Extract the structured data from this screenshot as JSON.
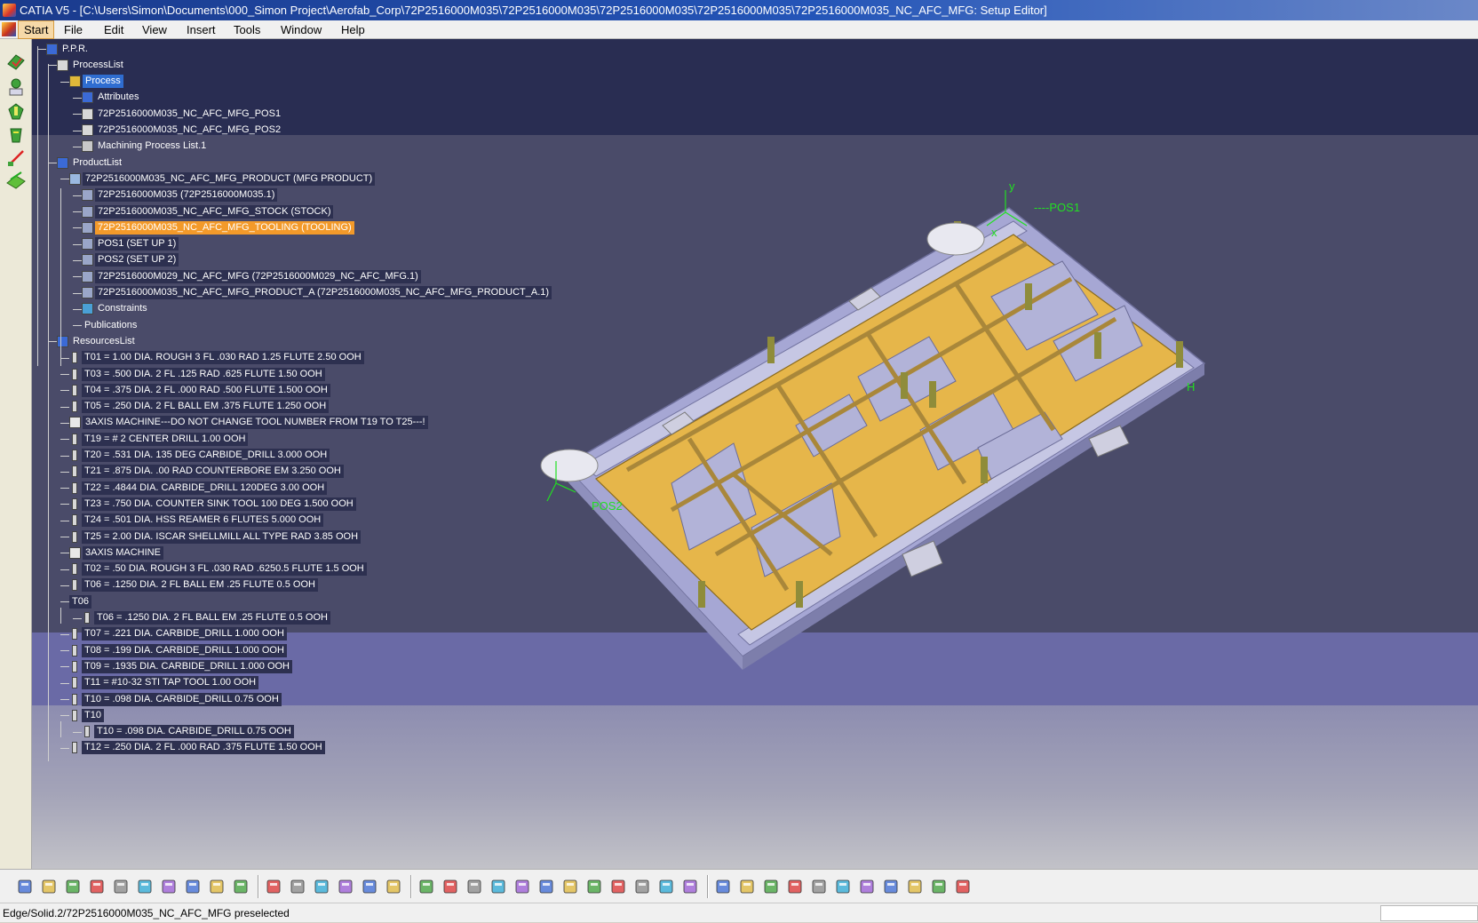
{
  "window": {
    "title": "CATIA V5 - [C:\\Users\\Simon\\Documents\\000_Simon Project\\Aerofab_Corp\\72P2516000M035\\72P2516000M035\\72P2516000M035\\72P2516000M035\\72P2516000M035_NC_AFC_MFG: Setup Editor]"
  },
  "menu": {
    "items": [
      {
        "label": "Start",
        "active": true
      },
      {
        "label": "File"
      },
      {
        "label": "Edit"
      },
      {
        "label": "View"
      },
      {
        "label": "Insert"
      },
      {
        "label": "Tools"
      },
      {
        "label": "Window"
      },
      {
        "label": "Help"
      }
    ]
  },
  "tree": {
    "nodes": [
      {
        "label": "P.P.R.",
        "level": 0,
        "icon": "ppr-icon",
        "style": "plain"
      },
      {
        "label": "ProcessList",
        "level": 1,
        "icon": "process-list-icon",
        "style": "plain"
      },
      {
        "label": "Process",
        "level": 2,
        "icon": "process-gear-icon",
        "style": "sel"
      },
      {
        "label": "Attributes",
        "level": 3,
        "icon": "attributes-icon",
        "style": "plain"
      },
      {
        "label": "72P2516000M035_NC_AFC_MFG_POS1",
        "level": 3,
        "icon": "part-operation-icon",
        "style": "plain"
      },
      {
        "label": "72P2516000M035_NC_AFC_MFG_POS2",
        "level": 3,
        "icon": "part-operation-icon",
        "style": "plain"
      },
      {
        "label": "Machining Process List.1",
        "level": 3,
        "icon": "machining-process-icon",
        "style": "plain"
      },
      {
        "label": "ProductList",
        "level": 1,
        "icon": "product-list-icon",
        "style": "plain"
      },
      {
        "label": "72P2516000M035_NC_AFC_MFG_PRODUCT (MFG PRODUCT)",
        "level": 2,
        "icon": "product-icon",
        "style": "box"
      },
      {
        "label": "72P2516000M035 (72P2516000M035.1)",
        "level": 3,
        "icon": "component-icon",
        "style": "box"
      },
      {
        "label": "72P2516000M035_NC_AFC_MFG_STOCK (STOCK)",
        "level": 3,
        "icon": "component-icon",
        "style": "box"
      },
      {
        "label": "72P2516000M035_NC_AFC_MFG_TOOLING (TOOLING)",
        "level": 3,
        "icon": "component-icon",
        "style": "hi"
      },
      {
        "label": "POS1 (SET UP 1)",
        "level": 3,
        "icon": "component-icon",
        "style": "box"
      },
      {
        "label": "POS2 (SET UP 2)",
        "level": 3,
        "icon": "component-icon",
        "style": "box"
      },
      {
        "label": "72P2516000M029_NC_AFC_MFG (72P2516000M029_NC_AFC_MFG.1)",
        "level": 3,
        "icon": "component-icon",
        "style": "box"
      },
      {
        "label": "72P2516000M035_NC_AFC_MFG_PRODUCT_A (72P2516000M035_NC_AFC_MFG_PRODUCT_A.1)",
        "level": 3,
        "icon": "component-icon",
        "style": "box"
      },
      {
        "label": "Constraints",
        "level": 3,
        "icon": "constraints-icon",
        "style": "plain"
      },
      {
        "label": "Publications",
        "level": 3,
        "icon": "none",
        "style": "plain"
      },
      {
        "label": "ResourcesList",
        "level": 1,
        "icon": "resources-list-icon",
        "style": "plain"
      },
      {
        "label": "T01 = 1.00 DIA. ROUGH 3 FL .030 RAD 1.25 FLUTE 2.50 OOH",
        "level": 2,
        "icon": "tool-icon",
        "style": "box"
      },
      {
        "label": "T03 = .500 DIA. 2 FL .125 RAD .625 FLUTE 1.50 OOH",
        "level": 2,
        "icon": "tool-icon",
        "style": "box"
      },
      {
        "label": "T04 = .375 DIA. 2 FL .000 RAD .500 FLUTE 1.500 OOH",
        "level": 2,
        "icon": "tool-icon",
        "style": "box"
      },
      {
        "label": "T05 = .250 DIA. 2 FL BALL EM .375 FLUTE 1.250 OOH",
        "level": 2,
        "icon": "tool-icon",
        "style": "box"
      },
      {
        "label": "3AXIS MACHINE---DO NOT CHANGE TOOL NUMBER FROM T19 TO T25---!",
        "level": 2,
        "icon": "machine-icon",
        "style": "box"
      },
      {
        "label": "T19 = # 2 CENTER DRILL 1.00 OOH",
        "level": 2,
        "icon": "tool-icon",
        "style": "box"
      },
      {
        "label": "T20 = .531 DIA. 135 DEG CARBIDE_DRILL 3.000 OOH",
        "level": 2,
        "icon": "tool-icon",
        "style": "box"
      },
      {
        "label": "T21 = .875 DIA. .00 RAD COUNTERBORE EM 3.250 OOH",
        "level": 2,
        "icon": "tool-icon",
        "style": "box"
      },
      {
        "label": "T22 = .4844 DIA. CARBIDE_DRILL 120DEG 3.00 OOH",
        "level": 2,
        "icon": "tool-icon",
        "style": "box"
      },
      {
        "label": "T23 = .750 DIA. COUNTER SINK TOOL 100 DEG 1.500 OOH",
        "level": 2,
        "icon": "tool-icon",
        "style": "box"
      },
      {
        "label": "T24 = .501 DIA. HSS REAMER 6 FLUTES  5.000 OOH",
        "level": 2,
        "icon": "tool-icon",
        "style": "box"
      },
      {
        "label": "T25 = 2.00 DIA. ISCAR SHELLMILL ALL TYPE RAD 3.85 OOH",
        "level": 2,
        "icon": "tool-icon",
        "style": "box"
      },
      {
        "label": "3AXIS MACHINE",
        "level": 2,
        "icon": "machine-icon",
        "style": "box"
      },
      {
        "label": "T02 = .50 DIA. ROUGH 3 FL .030 RAD .6250.5 FLUTE  1.5 OOH",
        "level": 2,
        "icon": "tool-icon",
        "style": "box"
      },
      {
        "label": "T06 = .1250 DIA. 2 FL BALL EM .25 FLUTE 0.5 OOH",
        "level": 2,
        "icon": "tool-icon",
        "style": "box"
      },
      {
        "label": "T06",
        "level": 2,
        "icon": "none",
        "style": "box"
      },
      {
        "label": "T06 = .1250 DIA. 2 FL BALL EM .25 FLUTE 0.5 OOH",
        "level": 3,
        "icon": "tool-icon",
        "style": "box"
      },
      {
        "label": "T07 = .221 DIA. CARBIDE_DRILL 1.000 OOH",
        "level": 2,
        "icon": "tool-icon",
        "style": "box"
      },
      {
        "label": "T08 = .199 DIA. CARBIDE_DRILL 1.000 OOH",
        "level": 2,
        "icon": "tool-icon",
        "style": "box"
      },
      {
        "label": "T09 = .1935 DIA. CARBIDE_DRILL 1.000 OOH",
        "level": 2,
        "icon": "tool-icon",
        "style": "box"
      },
      {
        "label": "T11 = #10-32 STI TAP TOOL 1.00 OOH",
        "level": 2,
        "icon": "tool-icon",
        "style": "box"
      },
      {
        "label": "T10 = .098 DIA. CARBIDE_DRILL 0.75 OOH",
        "level": 2,
        "icon": "tool-icon",
        "style": "box"
      },
      {
        "label": "T10",
        "level": 2,
        "icon": "tool-icon",
        "style": "box"
      },
      {
        "label": "T10 = .098 DIA. CARBIDE_DRILL 0.75 OOH",
        "level": 3,
        "icon": "tool-icon",
        "style": "box"
      },
      {
        "label": "T12 = .250 DIA. 2 FL .000 RAD .375 FLUTE 1.50 OOH",
        "level": 2,
        "icon": "tool-icon",
        "style": "box"
      }
    ]
  },
  "viewport": {
    "axis_labels": {
      "pos1": "----POS1",
      "pos2": "POS2",
      "x": "x",
      "y": "y",
      "h": "H"
    }
  },
  "toolbar_icons": [
    "new-icon",
    "open-icon",
    "save-icon",
    "print-icon",
    "cut-icon",
    "copy-icon",
    "paste-icon",
    "undo-icon",
    "redo-icon",
    "whats-this-icon",
    "formula-icon",
    "knowledge-advisor-icon",
    "measure-icon",
    "table-icon",
    "catalog-icon",
    "switch-icon",
    "fly-mode-icon",
    "fit-all-icon",
    "pan-icon",
    "rotate-icon",
    "zoom-in-icon",
    "zoom-out-icon",
    "normal-view-icon",
    "multi-view-icon",
    "iso-view-icon",
    "view-mode-icon",
    "hide-show-icon",
    "swap-visible-icon",
    "sketch-icon",
    "operation-table-icon",
    "tool-path-replay-icon",
    "video-icon",
    "machining-feature-icon",
    "compute-icon",
    "layout-icon",
    "manufacturing-view-icon",
    "nc-output-icon",
    "measure-between-icon",
    "measure-item-icon"
  ],
  "status": {
    "text": "Edge/Solid.2/72P2516000M035_NC_AFC_MFG preselected"
  },
  "colors": {
    "selection": "#2f6dd0",
    "highlight": "#f39a2a",
    "part": "#e6b64a",
    "fixture": "#a9aad6"
  }
}
